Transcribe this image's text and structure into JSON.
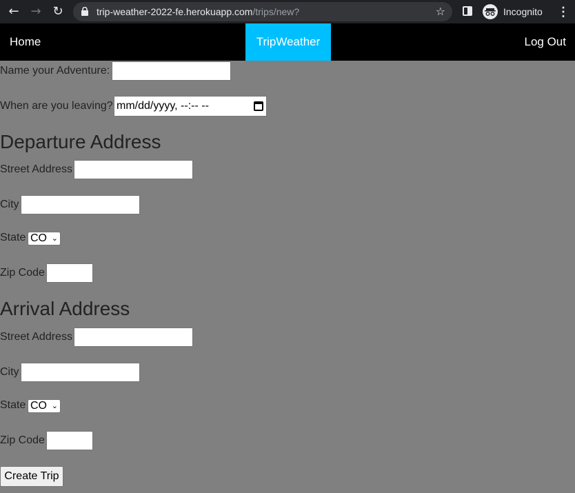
{
  "browser": {
    "url_host": "trip-weather-2022-fe.herokuapp.com",
    "url_path": "/trips/new?",
    "profile_label": "Incognito",
    "back_icon": "←",
    "forward_icon": "→",
    "reload_icon": "↻",
    "star_icon": "☆",
    "menu_icon": "⋮"
  },
  "nav": {
    "home": "Home",
    "brand": "TripWeather",
    "logout": "Log Out",
    "brand_color": "#00bfff"
  },
  "form": {
    "name_label": "Name your Adventure:",
    "name_value": "",
    "leaving_label": "When are you leaving?",
    "leaving_value": "mm/dd/yyyy, --:-- --",
    "departure": {
      "heading": "Departure Address",
      "street_label": "Street Address",
      "city_label": "City",
      "state_label": "State",
      "state_value": "CO",
      "zip_label": "Zip Code"
    },
    "arrival": {
      "heading": "Arrival Address",
      "street_label": "Street Address",
      "city_label": "City",
      "state_label": "State",
      "state_value": "CO",
      "zip_label": "Zip Code"
    },
    "submit_label": "Create Trip"
  }
}
